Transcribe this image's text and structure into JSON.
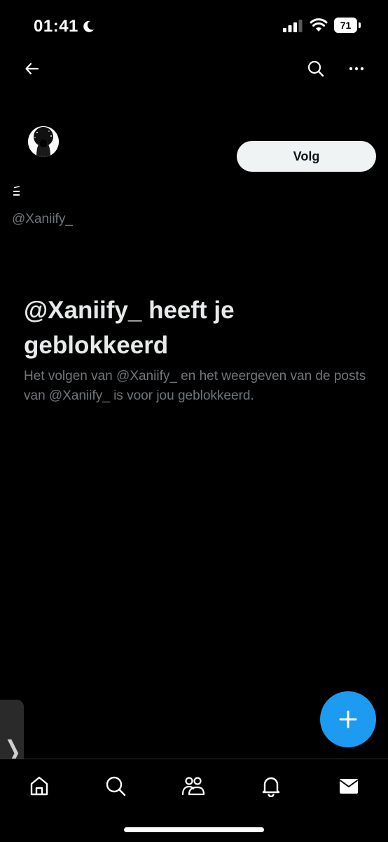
{
  "status_bar": {
    "time": "01:41",
    "battery": "71",
    "icons": [
      "moon-icon",
      "signal-icon",
      "wifi-icon",
      "battery-icon"
    ]
  },
  "top_nav": {
    "icons": [
      "arrow-left-icon",
      "search-icon",
      "more-horizontal-icon"
    ]
  },
  "profile": {
    "display_name": "",
    "handle": "@Xaniify_",
    "follow_label": "Volg"
  },
  "blocked": {
    "title": "@Xaniify_ heeft je geblokkeerd",
    "description": "Het volgen van @Xaniify_ en het weergeven van de posts van @Xaniify_ is voor jou geblokkeerd."
  },
  "side_handle": {
    "chevron": "❭"
  },
  "fab": {
    "icon": "plus-icon"
  },
  "tab_bar": {
    "tabs": [
      "home-icon",
      "search-icon",
      "communities-icon",
      "notifications-icon",
      "messages-icon"
    ]
  },
  "colors": {
    "background": "#000000",
    "accent": "#1d9bf0",
    "primary_text": "#e7e9ea",
    "secondary_text": "#71767b",
    "button_bg": "#eff3f4"
  }
}
